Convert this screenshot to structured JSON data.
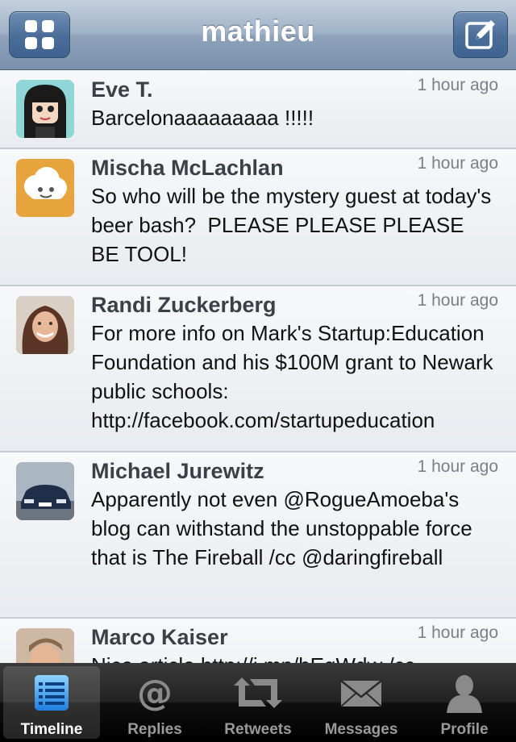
{
  "nav": {
    "title": "mathieu",
    "left_icon": "grid-icon",
    "right_icon": "compose-icon"
  },
  "tweets": [
    {
      "author": "Eve T.",
      "time": "1 hour ago",
      "text": "Barcelonaaaaaaaaa !!!!!"
    },
    {
      "author": "Mischa McLachlan",
      "time": "1 hour ago",
      "text": "So who will be the mystery guest at today's beer bash?  PLEASE PLEASE PLEASE BE TOOL!"
    },
    {
      "author": "Randi Zuckerberg",
      "time": "1 hour ago",
      "text": "For more info on Mark's Startup:Education Foundation and his $100M grant to Newark public schools: http://facebook.com/startupeducation"
    },
    {
      "author": "Michael Jurewitz",
      "time": "1 hour ago",
      "text": "Apparently not even @RogueAmoeba's blog can withstand the unstoppable force that is The Fireball /cc @daringfireball"
    },
    {
      "author": "Marco Kaiser",
      "time": "1 hour ago",
      "text": "Nice article http://j.mp/bEqWdw /cc"
    }
  ],
  "tabs": [
    {
      "label": "Timeline",
      "icon": "timeline-icon",
      "active": true
    },
    {
      "label": "Replies",
      "icon": "at-sign-icon"
    },
    {
      "label": "Retweets",
      "icon": "retweet-icon"
    },
    {
      "label": "Messages",
      "icon": "envelope-icon"
    },
    {
      "label": "Profile",
      "icon": "person-icon"
    }
  ],
  "colors": {
    "nav_top": "#c4d1df",
    "nav_bottom": "#7a90ab",
    "tab_active_icon": "#3aa0f0"
  }
}
